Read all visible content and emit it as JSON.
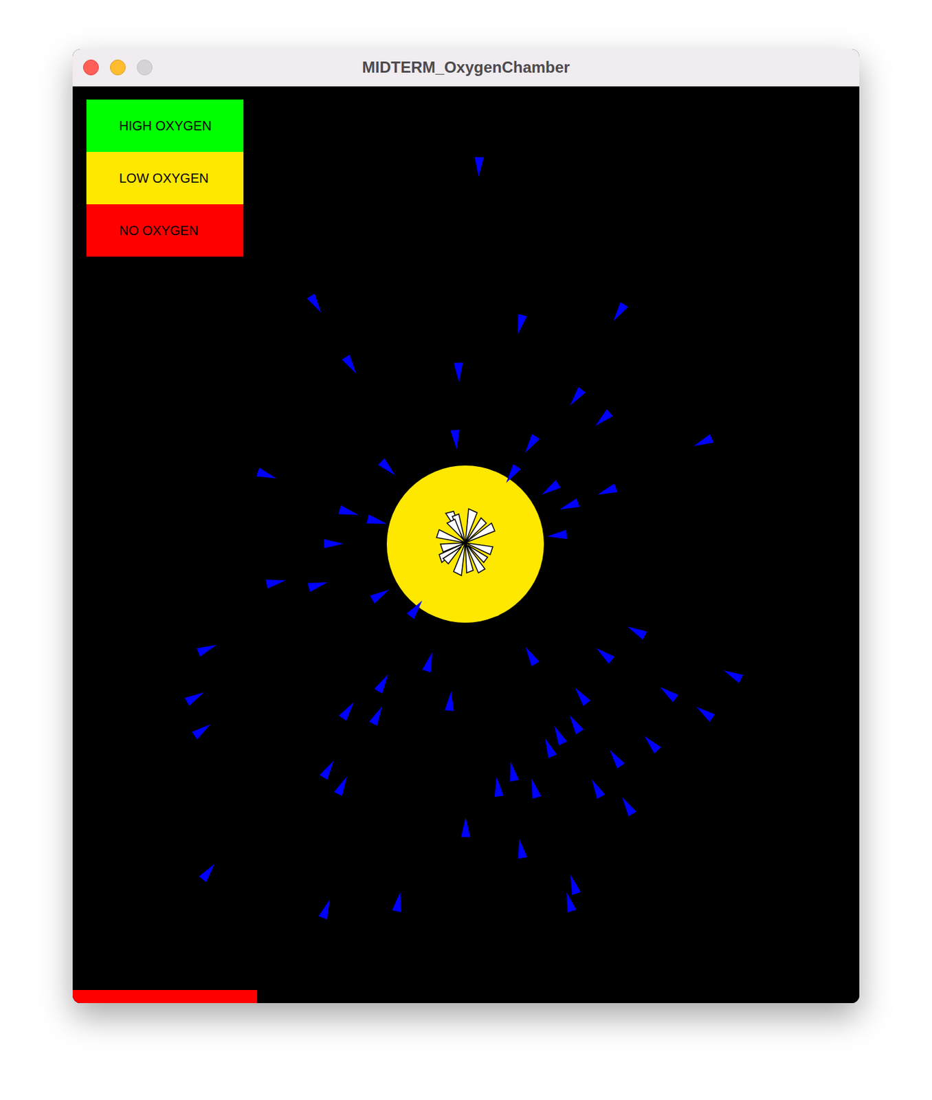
{
  "window": {
    "title": "MIDTERM_OxygenChamber"
  },
  "legend": [
    {
      "label": "HIGH OXYGEN",
      "color": "#00ff00"
    },
    {
      "label": "LOW OXYGEN",
      "color": "#ffe800"
    },
    {
      "label": "NO OXYGEN",
      "color": "#ff0000"
    }
  ],
  "chamber": {
    "color": "#ffe800"
  },
  "oxygen_bar": {
    "level": 0.235,
    "color": "#ff0000"
  }
}
